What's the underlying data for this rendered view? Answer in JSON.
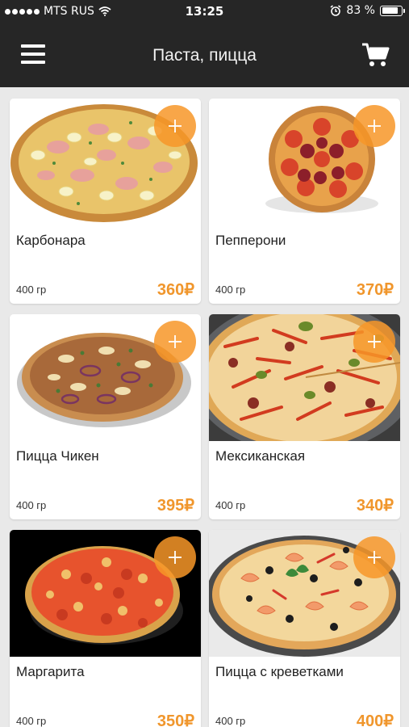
{
  "status_bar": {
    "carrier": "MTS RUS",
    "time": "13:25",
    "battery": "83 %",
    "battery_level": 0.83
  },
  "header": {
    "title": "Паста, пицца"
  },
  "colors": {
    "accent": "#f0962c",
    "bar": "#262626",
    "background": "#e9e9e9"
  },
  "products": [
    {
      "name": "Карбонара",
      "weight": "400 гр",
      "price": "360₽"
    },
    {
      "name": "Пепперони",
      "weight": "400 гр",
      "price": "370₽"
    },
    {
      "name": "Пицца Чикен",
      "weight": "400 гр",
      "price": "395₽"
    },
    {
      "name": "Мексиканская",
      "weight": "400 гр",
      "price": "340₽"
    },
    {
      "name": "Маргарита",
      "weight": "400 гр",
      "price": "350₽"
    },
    {
      "name": "Пицца с креветками",
      "weight": "400 гр",
      "price": "400₽"
    }
  ]
}
